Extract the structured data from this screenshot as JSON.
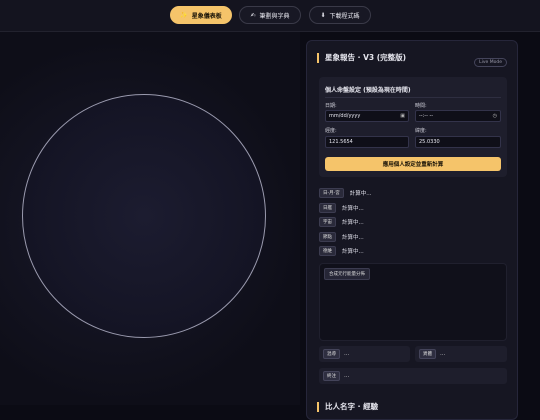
{
  "nav": {
    "tabs": [
      {
        "label": "星象儀表板",
        "icon": "sparkle-icon",
        "glyph": "✨",
        "active": true
      },
      {
        "label": "筆劃與字典",
        "icon": "pencil-icon",
        "glyph": "✍",
        "active": false
      },
      {
        "label": "下載程式碼",
        "icon": "download-icon",
        "glyph": "⬇",
        "active": false
      }
    ]
  },
  "panel": {
    "title": "星象報告 · V3 (完整版)",
    "badge": "Live Mode",
    "settings": {
      "title": "個人命盤設定 (預設為現在時間)",
      "date_label": "日期:",
      "date_value": "mm/dd/yyyy",
      "time_label": "時間:",
      "time_value": "--:--  --",
      "lon_label": "經度:",
      "lon_value": "121.5654",
      "lat_label": "緯度:",
      "lat_value": "25.0330",
      "apply_label": "應用個人設定並重新計算"
    },
    "planets": [
      {
        "tag": "日-月-宮",
        "value": "計算中..."
      },
      {
        "tag": "日艦",
        "value": "計算中..."
      },
      {
        "tag": "宇宙",
        "value": "計算中..."
      },
      {
        "tag": "節點",
        "value": "計算中..."
      },
      {
        "tag": "德維",
        "value": "計算中..."
      }
    ],
    "synth_button": "合成元行能量分佈",
    "mini": [
      {
        "tag": "混導",
        "value": "..."
      },
      {
        "tag": "異體",
        "value": "..."
      },
      {
        "tag": "終注",
        "value": "..."
      }
    ],
    "bottom_title": "比人名字 · 經驗"
  },
  "colors": {
    "accent": "#f5c46a",
    "background": "#0b0b14",
    "panel": "#161622"
  }
}
